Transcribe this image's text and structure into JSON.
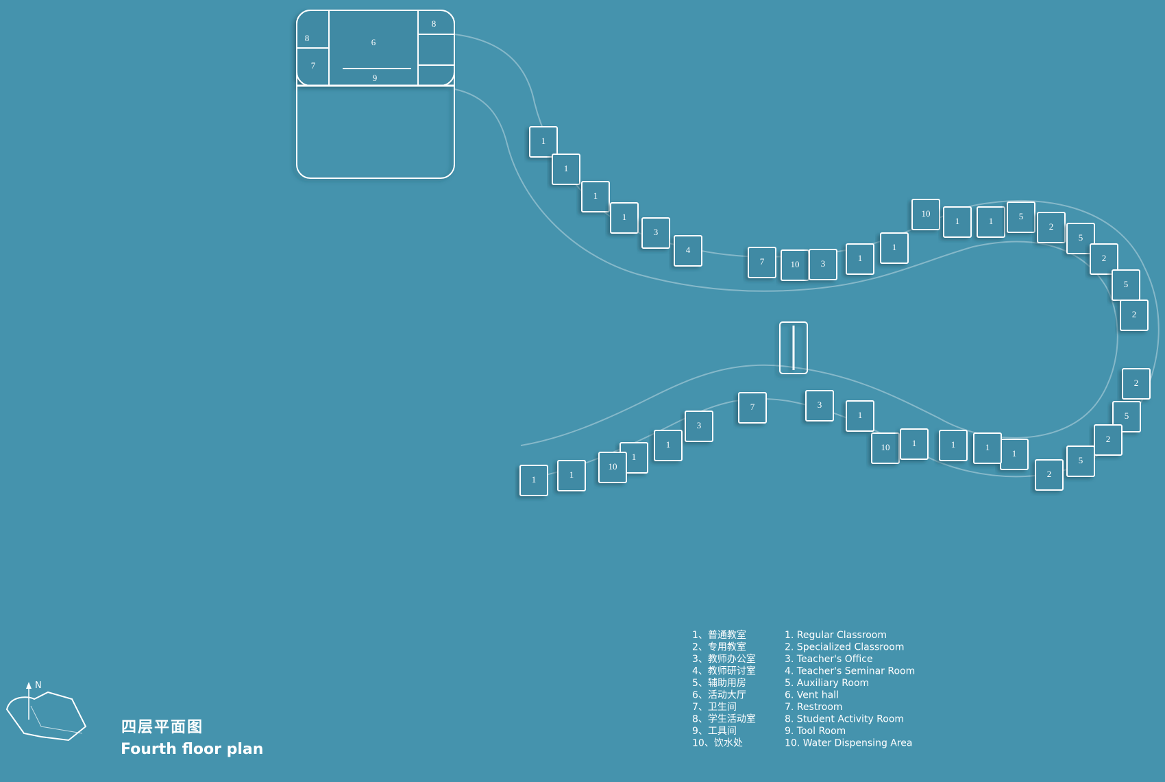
{
  "plan": {
    "title_cn": "四层平面图",
    "title_en": "Fourth floor plan",
    "compass_label": "N"
  },
  "rooms": [
    {
      "label": "8"
    },
    {
      "label": "6"
    },
    {
      "label": "8"
    },
    {
      "label": "7"
    },
    {
      "label": "9"
    },
    {
      "label": "1"
    },
    {
      "label": "1"
    },
    {
      "label": "1"
    },
    {
      "label": "1"
    },
    {
      "label": "3"
    },
    {
      "label": "4"
    },
    {
      "label": "7"
    },
    {
      "label": "10"
    },
    {
      "label": "3"
    },
    {
      "label": "1"
    },
    {
      "label": "1"
    },
    {
      "label": "10"
    },
    {
      "label": "1"
    },
    {
      "label": "1"
    },
    {
      "label": "5"
    },
    {
      "label": "2"
    },
    {
      "label": "5"
    },
    {
      "label": "2"
    },
    {
      "label": "5"
    },
    {
      "label": "2"
    },
    {
      "label": "2"
    },
    {
      "label": "5"
    },
    {
      "label": "2"
    },
    {
      "label": "5"
    },
    {
      "label": "2"
    },
    {
      "label": "1"
    },
    {
      "label": "1"
    },
    {
      "label": "1"
    },
    {
      "label": "10"
    },
    {
      "label": "1"
    },
    {
      "label": "1"
    },
    {
      "label": "3"
    },
    {
      "label": "7"
    },
    {
      "label": "3"
    },
    {
      "label": "1"
    },
    {
      "label": "1"
    },
    {
      "label": "10"
    },
    {
      "label": "1"
    },
    {
      "label": "1"
    }
  ],
  "legend": {
    "cn": [
      "1、普通教室",
      "2、专用教室",
      "3、教师办公室",
      "4、教师研讨室",
      "5、辅助用房",
      "6、活动大厅",
      "7、卫生间",
      "8、学生活动室",
      "9、工具间",
      "10、饮水处"
    ],
    "en": [
      "1. Regular Classroom",
      "2. Specialized Classroom",
      "3. Teacher's Office",
      "4. Teacher's Seminar Room",
      "5. Auxiliary Room",
      "6. Vent hall",
      "7. Restroom",
      "8. Student Activity Room",
      "9. Tool Room",
      "10. Water Dispensing Area"
    ]
  },
  "colors": {
    "background": "#4593ad",
    "wall": "#ffffff",
    "room_fill": "#3f8aa4"
  }
}
